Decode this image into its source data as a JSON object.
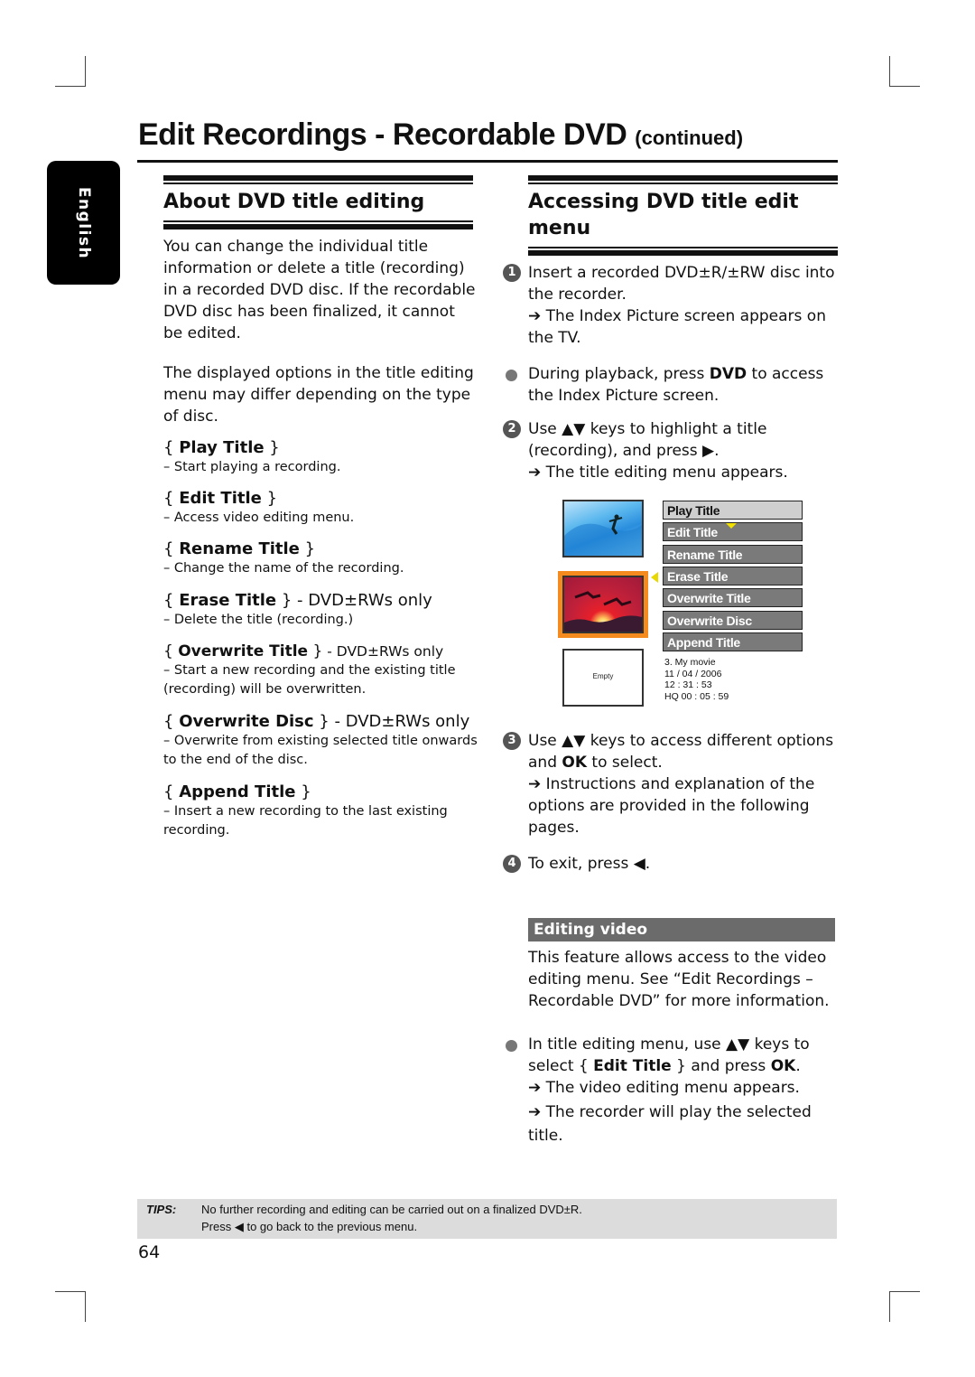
{
  "page": {
    "title": "Edit Recordings - Recordable DVD",
    "title_suffix": "(continued)",
    "language_tab": "English",
    "page_number": "64"
  },
  "left": {
    "heading": "About DVD title editing",
    "para1": "You can change the individual title information or delete a title (recording) in a recorded DVD disc. If the recordable DVD disc has been finalized, it cannot be edited.",
    "para2": "The displayed options in the title editing menu may differ depending on the type of disc.",
    "options": [
      {
        "name": "Play Title",
        "suffix": "",
        "desc": "Start playing a recording."
      },
      {
        "name": "Edit Title",
        "suffix": "",
        "desc": "Access video editing menu."
      },
      {
        "name": "Rename Title",
        "suffix": "",
        "desc": "Change the name of the recording."
      },
      {
        "name": "Erase Title",
        "suffix": " - DVD±RWs only",
        "desc": "Delete the title (recording.)"
      },
      {
        "name": "Overwrite Title",
        "suffix": " - DVD±RWs only",
        "desc": "Start a new recording and the existing title (recording) will be overwritten."
      },
      {
        "name": "Overwrite Disc",
        "suffix": " - DVD±RWs only",
        "desc": "Overwrite from existing selected title onwards to the end of the disc."
      },
      {
        "name": "Append Title",
        "suffix": "",
        "desc": "Insert a new recording to the last existing recording."
      }
    ]
  },
  "right": {
    "heading": "Accessing DVD title edit menu",
    "steps": [
      {
        "marker": "1",
        "text": "Insert a recorded DVD±R/±RW disc into the recorder.",
        "result": "The Index Picture screen appears on the TV."
      },
      {
        "marker": "bullet",
        "pre": "During playback, press ",
        "key": "DVD",
        "post": " to access the Index Picture screen."
      },
      {
        "marker": "2",
        "pre": "Use ▲▼ keys to highlight a title (recording), and press ▶.",
        "result": "The title editing menu appears."
      },
      {
        "marker": "3",
        "pre": "Use ▲▼ keys to access different options and ",
        "key": "OK",
        "post": " to select.",
        "result": "Instructions and explanation of the options are provided in the following pages."
      },
      {
        "marker": "4",
        "text": "To exit, press ◀."
      }
    ],
    "screen": {
      "menu_items": [
        "Play Title",
        "Edit Title",
        "Rename Title",
        "Erase Title",
        "Overwrite Title",
        "Overwrite Disc",
        "Append Title"
      ],
      "selected_index": 0,
      "thumbnails": [
        "surfer",
        "sunset-birds",
        "Empty"
      ],
      "info": {
        "name": "3. My movie",
        "date": "11 / 04 / 2006",
        "time": "12 : 31 : 53",
        "duration": "HQ 00 : 05 : 59"
      }
    },
    "sub_heading": "Editing video",
    "sub_para": "This feature allows access to the video editing menu. See “Edit Recordings – Recordable DVD” for more information.",
    "sub_step": {
      "pre": "In title editing menu, use ▲▼ keys to select { ",
      "bold": "Edit Title",
      "mid": " } and press ",
      "key": "OK",
      "post": ".",
      "results": [
        "The video editing menu appears.",
        "The recorder will play the selected title."
      ]
    }
  },
  "tips": {
    "label": "TIPS:",
    "lines": [
      "No further recording and editing can be carried out on a finalized DVD±R.",
      "Press ◀ to go back to the previous menu."
    ]
  },
  "symbols": {
    "arrow": "➔",
    "brace_open": "{ ",
    "brace_close": " }",
    "dash": "–  "
  }
}
